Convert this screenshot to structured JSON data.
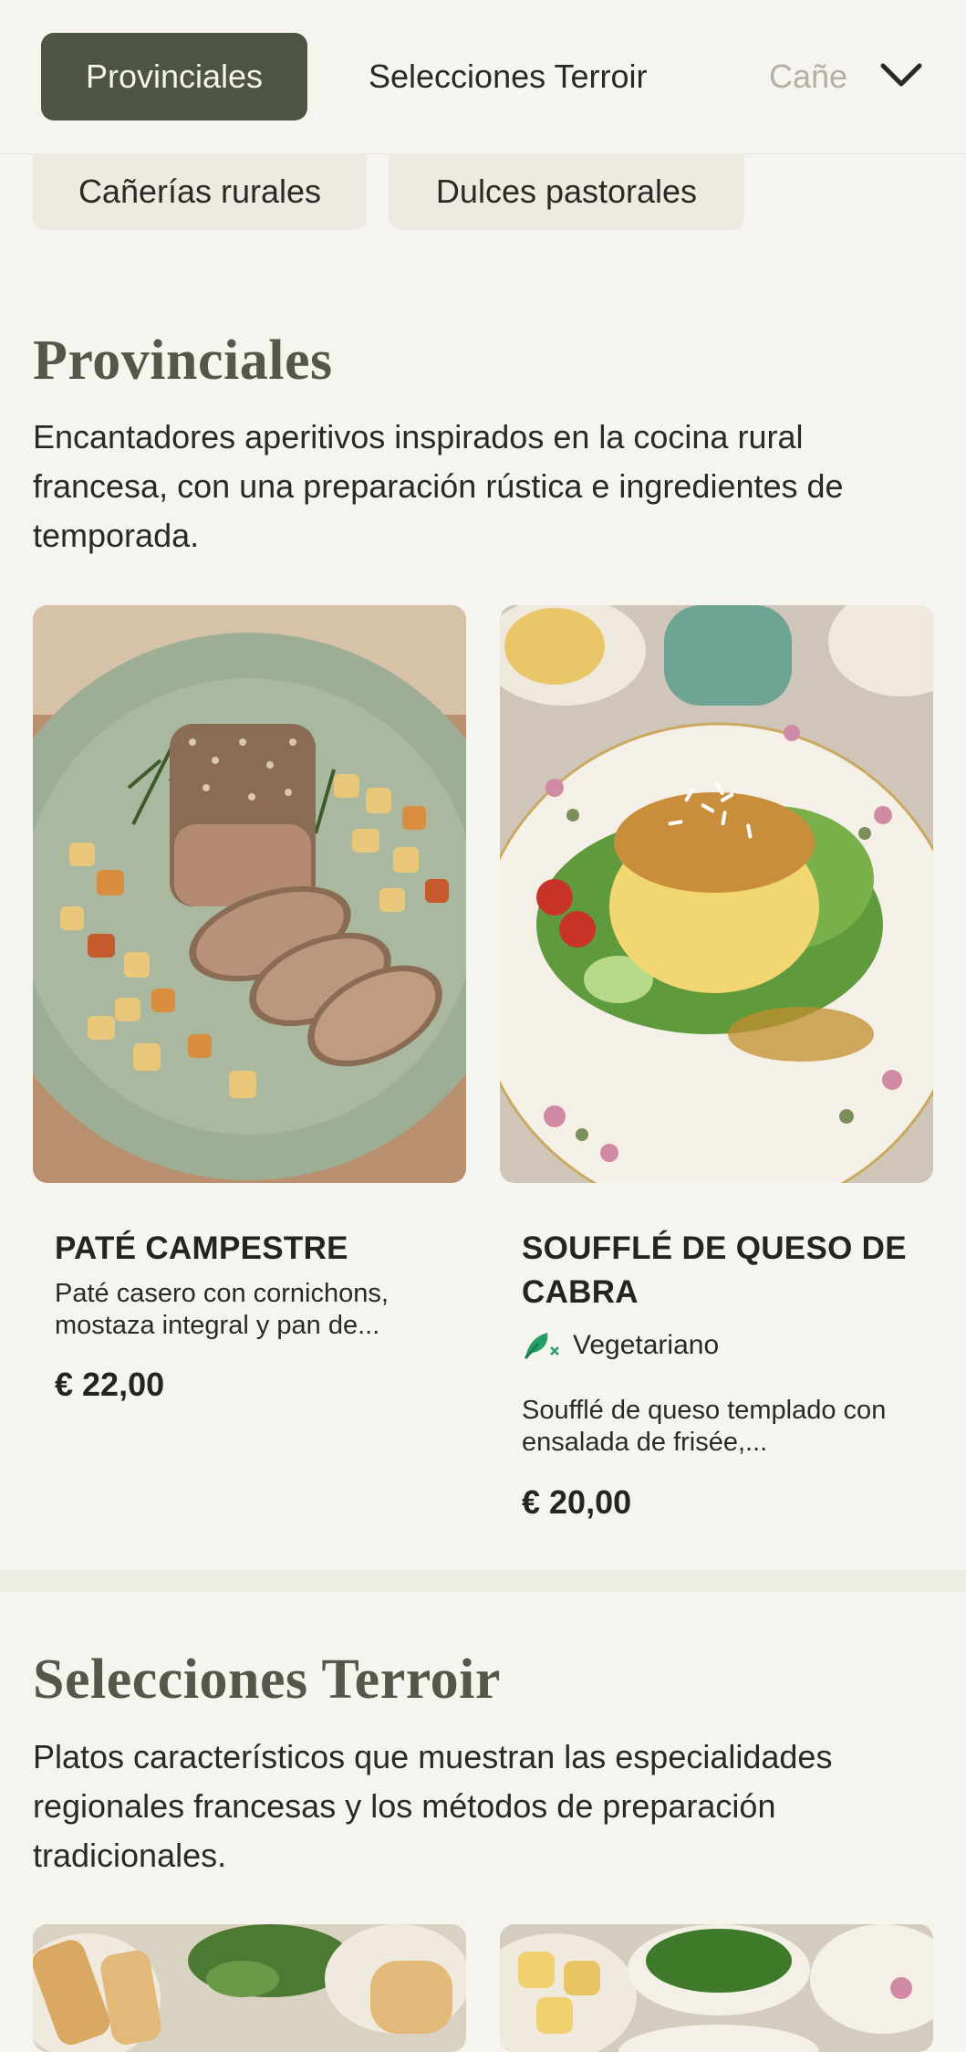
{
  "nav": {
    "tabs": [
      {
        "label": "Provinciales",
        "active": true
      },
      {
        "label": "Selecciones Terroir",
        "active": false
      },
      {
        "label": "Cañe",
        "active": false
      }
    ],
    "chips": [
      {
        "label": "Cañerías rurales"
      },
      {
        "label": "Dulces pastorales"
      }
    ],
    "expand_icon": "chevron-down-icon"
  },
  "sections": [
    {
      "title": "Provinciales",
      "description": "Encantadores aperitivos inspirados en la cocina rural francesa, con una preparación rústica e ingredientes de temporada.",
      "items": [
        {
          "name": "PATÉ CAMPESTRE",
          "description": "Paté casero con cornichons, mostaza integral y pan de...",
          "price": "€ 22,00",
          "image": "pate-plate-image"
        },
        {
          "name": "SOUFFLÉ DE QUESO DE CABRA",
          "badge": "Vegetariano",
          "badge_icon": "vegetarian-leaf-icon",
          "description": "Soufflé de queso templado con ensalada de frisée,...",
          "price": "€ 20,00",
          "image": "souffle-plate-image"
        }
      ]
    },
    {
      "title": "Selecciones Terroir",
      "description": "Platos característicos que muestran las especialidades regionales francesas y los métodos de preparación tradicionales.",
      "items": [
        {
          "image": "bread-herbs-image"
        },
        {
          "image": "potatoes-salad-image"
        }
      ]
    }
  ],
  "colors": {
    "background": "#f6f4ee",
    "active_tab": "#4d5442",
    "heading": "#55574b",
    "vegetarian": "#23a06a"
  }
}
